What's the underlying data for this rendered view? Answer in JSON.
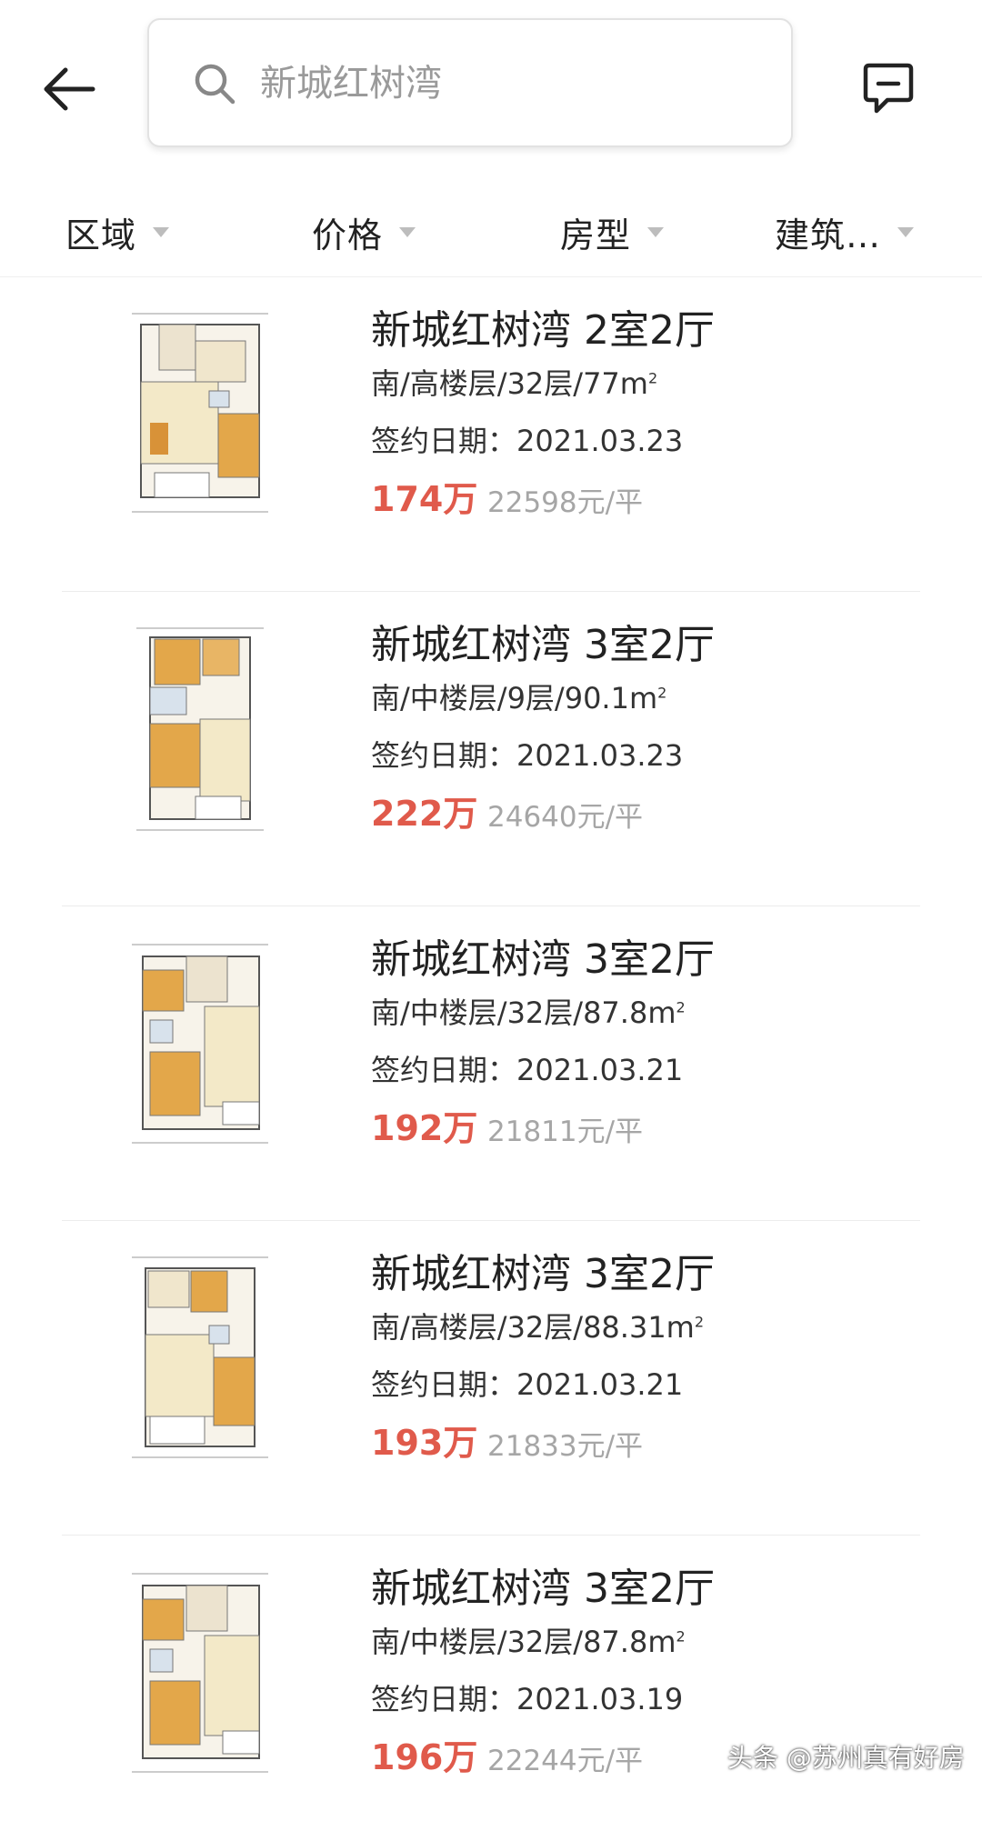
{
  "search": {
    "placeholder": "新城红树湾"
  },
  "filters": [
    {
      "label": "区域"
    },
    {
      "label": "价格"
    },
    {
      "label": "房型"
    },
    {
      "label": "建筑…"
    }
  ],
  "listings": [
    {
      "title": "新城红树湾 2室2厅",
      "detail": "南/高楼层/32层/77m",
      "sup": "2",
      "date": "签约日期：2021.03.23",
      "price": "174万",
      "unit_price": "22598元/平"
    },
    {
      "title": "新城红树湾 3室2厅",
      "detail": "南/中楼层/9层/90.1m",
      "sup": "2",
      "date": "签约日期：2021.03.23",
      "price": "222万",
      "unit_price": "24640元/平"
    },
    {
      "title": "新城红树湾 3室2厅",
      "detail": "南/中楼层/32层/87.8m",
      "sup": "2",
      "date": "签约日期：2021.03.21",
      "price": "192万",
      "unit_price": "21811元/平"
    },
    {
      "title": "新城红树湾 3室2厅",
      "detail": "南/高楼层/32层/88.31m",
      "sup": "2",
      "date": "签约日期：2021.03.21",
      "price": "193万",
      "unit_price": "21833元/平"
    },
    {
      "title": "新城红树湾 3室2厅",
      "detail": "南/中楼层/32层/87.8m",
      "sup": "2",
      "date": "签约日期：2021.03.19",
      "price": "196万",
      "unit_price": "22244元/平"
    }
  ],
  "watermark": "头条 @苏州真有好房",
  "colors": {
    "price": "#e05a4b",
    "unit_price": "#a6a6a6",
    "text": "#222222"
  }
}
